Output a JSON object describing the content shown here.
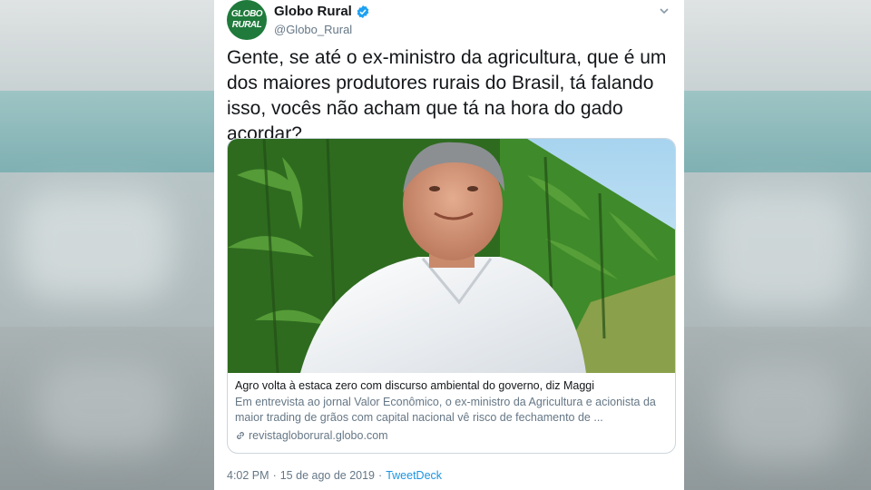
{
  "tweet": {
    "display_name": "Globo Rural",
    "handle": "@Globo_Rural",
    "avatar_text": [
      "GLOBO",
      "RURAL"
    ],
    "text": "Gente, se até o ex-ministro da agricultura, que é um dos maiores produtores rurais do Brasil, tá falando isso, vocês não acham que tá na hora do gado acordar?",
    "link_card": {
      "title": "Agro volta à estaca zero com discurso ambiental do governo, diz Maggi",
      "description": "Em entrevista ao jornal Valor Econômico, o ex-ministro da Agricultura e acionista da maior trading de grãos com capital nacional vê risco de fechamento de ...",
      "domain": "revistagloborural.globo.com"
    },
    "time": "4:02 PM",
    "date": "15 de ago de 2019",
    "source": "TweetDeck"
  },
  "colors": {
    "verified": "#1da1f2",
    "link": "#1b95e0",
    "secondary_text": "#657786",
    "avatar_bg": "#1f7a3b"
  },
  "icons": {
    "verified": "verified-badge-icon",
    "caret": "chevron-down-icon",
    "link": "link-icon"
  }
}
